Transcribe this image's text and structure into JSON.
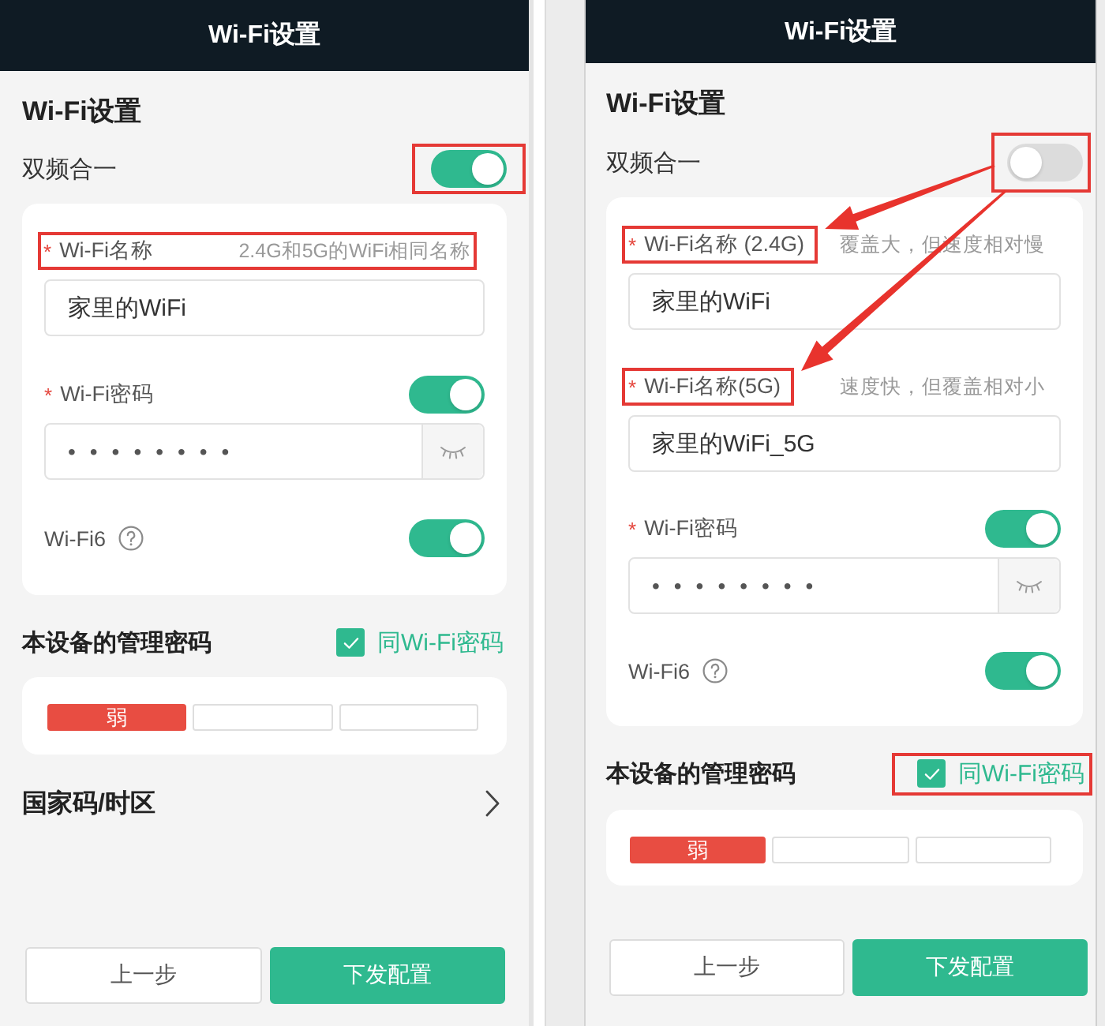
{
  "screens": [
    {
      "header": {
        "title": "Wi-Fi设置"
      },
      "section_title": "Wi-Fi设置",
      "arrows": false,
      "dual_band": {
        "label": "双频合一",
        "on": true,
        "boxed": true
      },
      "fields": [
        {
          "kind": "name",
          "required_mark": "*",
          "label": "Wi-Fi名称",
          "hint": "2.4G和5G的WiFi相同名称",
          "value": "家里的WiFi",
          "label_boxed": true,
          "hint_boxed": true
        },
        {
          "kind": "password",
          "required_mark": "*",
          "label": "Wi-Fi密码",
          "on": true,
          "value": "••••••••"
        },
        {
          "kind": "switch",
          "label": "Wi-Fi6",
          "on": true
        }
      ],
      "admin_password": {
        "title": "本设备的管理密码",
        "same_as_wifi": {
          "label": "同Wi-Fi密码",
          "checked": true,
          "boxed": false
        },
        "strength": [
          {
            "label": "弱",
            "lit": true
          },
          {
            "lit": false
          },
          {
            "lit": false
          }
        ]
      },
      "country": {
        "label": "国家码/时区"
      },
      "buttons": [
        {
          "kind": "secondary",
          "label": "上一步"
        },
        {
          "kind": "primary",
          "label": "下发配置"
        }
      ]
    },
    {
      "header": {
        "title": "Wi-Fi设置"
      },
      "section_title": "Wi-Fi设置",
      "arrows": true,
      "dual_band": {
        "label": "双频合一",
        "on": false,
        "boxed": true
      },
      "fields": [
        {
          "kind": "name",
          "required_mark": "*",
          "label": "Wi-Fi名称 (2.4G)",
          "hint": "覆盖大，但速度相对慢",
          "value": "家里的WiFi",
          "label_boxed": true
        },
        {
          "kind": "name",
          "required_mark": "*",
          "label": "Wi-Fi名称(5G)",
          "hint": "速度快，但覆盖相对小",
          "value": "家里的WiFi_5G",
          "label_boxed": true
        },
        {
          "kind": "password",
          "required_mark": "*",
          "label": "Wi-Fi密码",
          "on": true,
          "value": "••••••••"
        },
        {
          "kind": "switch",
          "label": "Wi-Fi6",
          "on": true
        }
      ],
      "admin_password": {
        "title": "本设备的管理密码",
        "same_as_wifi": {
          "label": "同Wi-Fi密码",
          "checked": true,
          "boxed": true
        },
        "strength": [
          {
            "label": "弱",
            "lit": true
          },
          {
            "lit": false
          },
          {
            "lit": false
          }
        ]
      },
      "buttons": [
        {
          "kind": "secondary",
          "label": "上一步"
        },
        {
          "kind": "primary",
          "label": "下发配置"
        }
      ]
    }
  ]
}
